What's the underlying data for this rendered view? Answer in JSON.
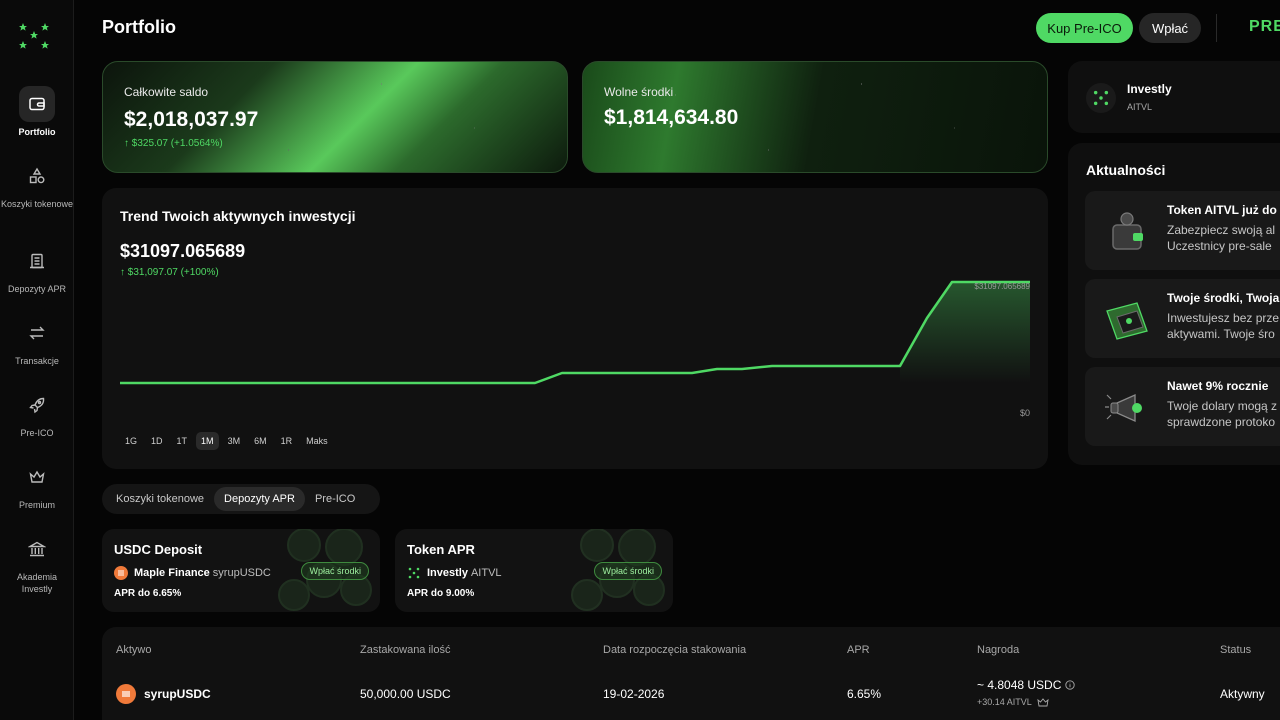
{
  "header": {
    "title": "Portfolio",
    "buy_button": "Kup Pre-ICO",
    "deposit_button": "Wpłać",
    "premium_tag": "PREM"
  },
  "sidebar": {
    "items": [
      {
        "label": "Portfolio",
        "icon": "wallet-icon",
        "active": true
      },
      {
        "label": "Koszyki tokenowe",
        "icon": "shapes-icon",
        "active": false
      },
      {
        "label": "Depozyty APR",
        "icon": "bank-building-icon",
        "active": false
      },
      {
        "label": "Transakcje",
        "icon": "arrows-swap-icon",
        "active": false
      },
      {
        "label": "Pre-ICO",
        "icon": "rocket-icon",
        "active": false
      },
      {
        "label": "Premium",
        "icon": "crown-icon",
        "active": false
      },
      {
        "label": "Akademia Investly",
        "icon": "academy-icon",
        "active": false
      }
    ]
  },
  "balances": {
    "total": {
      "label": "Całkowite saldo",
      "value": "$2,018,037.97",
      "change": "↑ $325.07 (+1.0564%)"
    },
    "free": {
      "label": "Wolne środki",
      "value": "$1,814,634.80"
    }
  },
  "trend": {
    "title": "Trend Twoich aktywnych inwestycji",
    "value": "$31097.065689",
    "change": "↑ $31,097.07 (+100%)",
    "ranges": [
      "1G",
      "1D",
      "1T",
      "1M",
      "3M",
      "6M",
      "1R",
      "Maks"
    ],
    "active_range": "1M"
  },
  "chart_data": {
    "type": "area",
    "x": [
      0,
      1,
      2,
      3,
      4,
      5,
      6,
      7,
      8,
      9,
      10,
      11,
      12,
      13,
      14,
      15,
      16,
      17,
      18,
      19,
      20
    ],
    "values": [
      0,
      0,
      0,
      0,
      0,
      0,
      0,
      0,
      0,
      0,
      0,
      0,
      0,
      0,
      0,
      0,
      0,
      0,
      0,
      0,
      0
    ],
    "shape": [
      0,
      0,
      0,
      0,
      0,
      0,
      0,
      0,
      0,
      0,
      0,
      0,
      0,
      0,
      0,
      0,
      0,
      0,
      0,
      0,
      0
    ],
    "points_y": [
      -0.5,
      -0.5,
      -0.5,
      -0.5,
      -0.5,
      -0.5,
      -0.5,
      -0.5,
      -0.5,
      -0.5,
      0.5,
      0.5,
      0.5,
      0.5,
      1.5,
      1.5,
      2,
      2,
      2,
      2,
      2
    ],
    "end_label": "$31097.065689",
    "zero_label": "$0",
    "grid": false,
    "color": "#4fd964"
  },
  "tabs": {
    "items": [
      "Koszyki tokenowe",
      "Depozyty APR",
      "Pre-ICO"
    ],
    "active": "Depozyty APR"
  },
  "products": [
    {
      "title": "USDC Deposit",
      "source": "Maple Finance",
      "source_sub": "syrupUSDC",
      "apr": "APR do 6.65%",
      "button": "Wpłać środki"
    },
    {
      "title": "Token APR",
      "source": "Investly",
      "source_sub": "AITVL",
      "apr": "APR do 9.00%",
      "button": "Wpłać środki"
    }
  ],
  "table": {
    "headers": [
      "Aktywo",
      "Zastakowana ilość",
      "Data rozpoczęcia stakowania",
      "APR",
      "Nagroda",
      "Status"
    ],
    "rows": [
      {
        "asset": "syrupUSDC",
        "amount": "50,000.00 USDC",
        "date": "19-02-2026",
        "apr": "6.65%",
        "reward": "~ 4.8048 USDC",
        "reward_sub": "+30.14 AITVL",
        "status": "Aktywny"
      }
    ]
  },
  "investly": {
    "name": "Investly",
    "ticker": "AITVL"
  },
  "news": {
    "title": "Aktualności",
    "items": [
      {
        "title": "Token AITVL już do",
        "line1": "Zabezpiecz swoją al",
        "line2": "Uczestnicy pre-sale",
        "icon": "wallet-coins-icon"
      },
      {
        "title": "Twoje środki, Twoja",
        "line1": "Inwestujesz bez prze",
        "line2": "aktywami. Twoje śro",
        "icon": "secure-folder-icon"
      },
      {
        "title": "Nawet 9% rocznie",
        "line1": "Twoje dolary mogą z",
        "line2": "sprawdzone protoko",
        "icon": "megaphone-icon"
      }
    ]
  },
  "colors": {
    "accent": "#4fd964",
    "background": "#050505",
    "card": "#111111"
  }
}
